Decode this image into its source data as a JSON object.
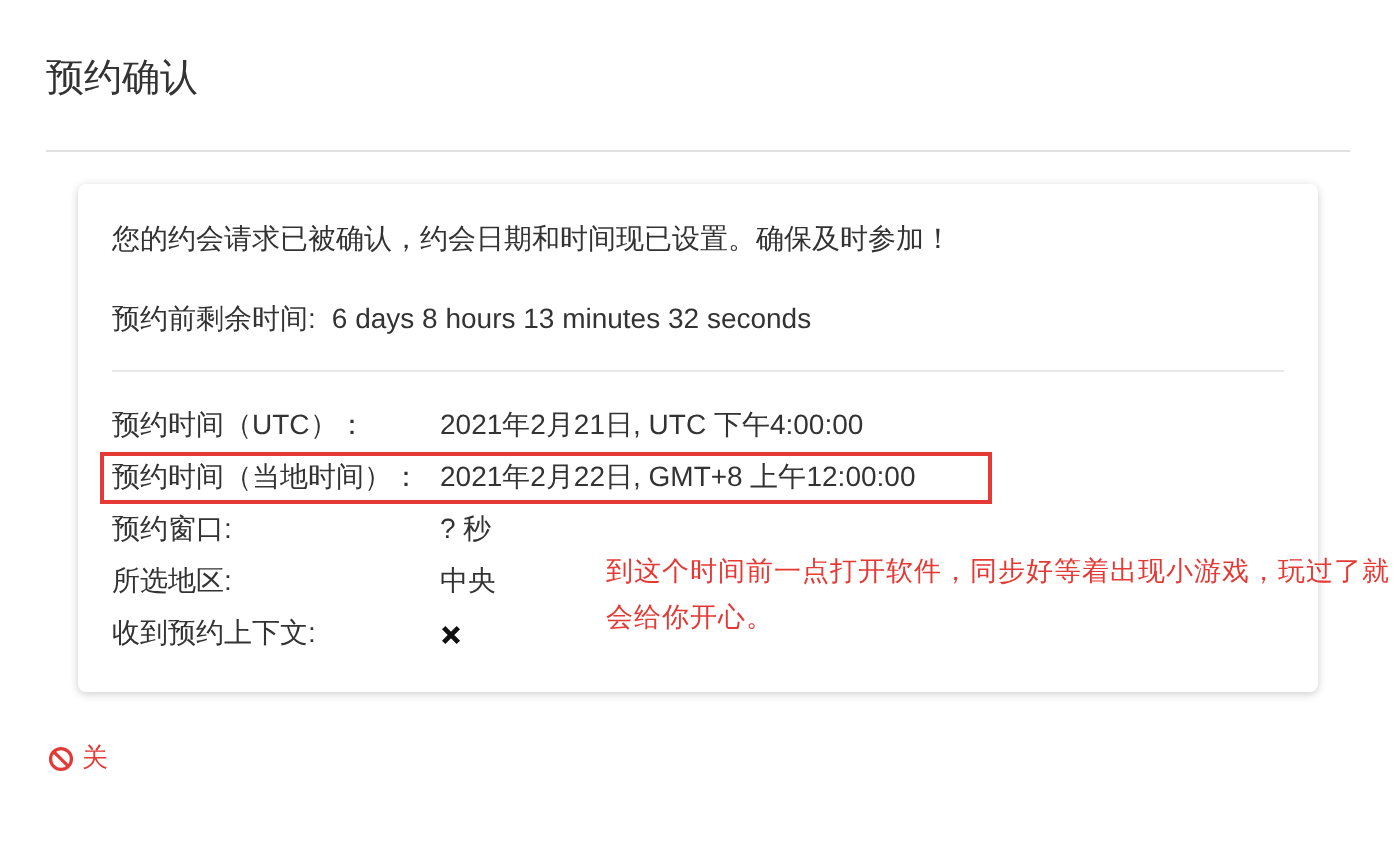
{
  "title": "预约确认",
  "card": {
    "message": "您的约会请求已被确认，约会日期和时间现已设置。确保及时参加！",
    "countdown": {
      "label": "预约前剩余时间:",
      "value": "6 days 8 hours 13 minutes 32 seconds"
    },
    "details": [
      {
        "kind": "text",
        "label": "预约时间（UTC）：",
        "value": "2021年2月21日, UTC 下午4:00:00",
        "highlighted": false
      },
      {
        "kind": "text",
        "label": "预约时间（当地时间）：",
        "value": "2021年2月22日, GMT+8 上午12:00:00",
        "highlighted": true
      },
      {
        "kind": "text",
        "label": "预约窗口:",
        "value": "? 秒",
        "highlighted": false
      },
      {
        "kind": "text",
        "label": "所选地区:",
        "value": "中央",
        "highlighted": false
      },
      {
        "kind": "flag",
        "label": "收到预约上下文:",
        "checked": false,
        "highlighted": false
      }
    ],
    "annotation": "到这个时间前一点打开软件，同步好等着出现小游戏，玩过了就会给你开心。"
  },
  "close_button": {
    "label": "关"
  }
}
